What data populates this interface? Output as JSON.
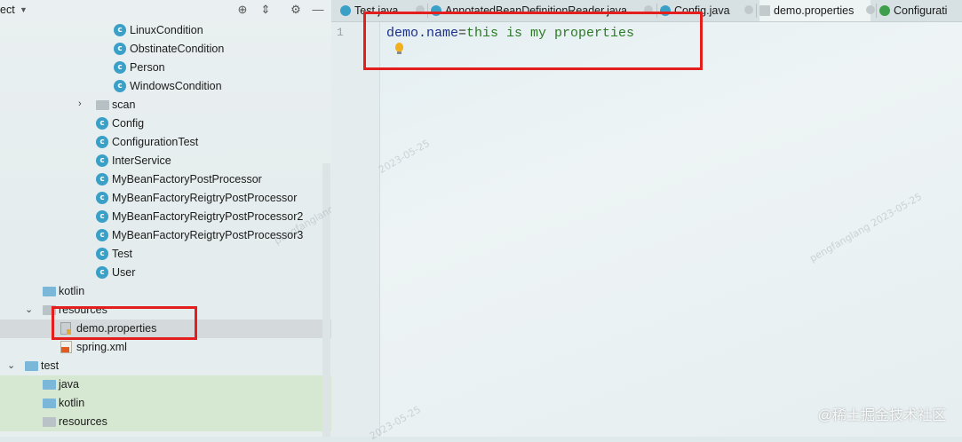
{
  "left_panel": {
    "title": "ect",
    "tree": [
      {
        "label": "LinuxCondition",
        "icon": "class-icon",
        "indent": 128
      },
      {
        "label": "ObstinateCondition",
        "icon": "class-icon",
        "indent": 128
      },
      {
        "label": "Person",
        "icon": "class-icon",
        "indent": 128
      },
      {
        "label": "WindowsCondition",
        "icon": "class-icon",
        "indent": 128
      },
      {
        "label": "scan",
        "icon": "folder-icon",
        "indent": 108,
        "arrow": "›"
      },
      {
        "label": "Config",
        "icon": "class-icon",
        "indent": 108
      },
      {
        "label": "ConfigurationTest",
        "icon": "class-icon",
        "indent": 108
      },
      {
        "label": "InterService",
        "icon": "class-icon",
        "indent": 108
      },
      {
        "label": "MyBeanFactoryPostProcessor",
        "icon": "class-icon",
        "indent": 108
      },
      {
        "label": "MyBeanFactoryReigtryPostProcessor",
        "icon": "class-icon",
        "indent": 108
      },
      {
        "label": "MyBeanFactoryReigtryPostProcessor2",
        "icon": "class-icon",
        "indent": 108
      },
      {
        "label": "MyBeanFactoryReigtryPostProcessor3",
        "icon": "class-icon",
        "indent": 108
      },
      {
        "label": "Test",
        "icon": "class-icon",
        "indent": 108
      },
      {
        "label": "User",
        "icon": "class-icon",
        "indent": 108
      },
      {
        "label": "kotlin",
        "icon": "folder-icon",
        "indent": 48
      },
      {
        "label": "resources",
        "icon": "folder-icon",
        "indent": 48,
        "arrow": "⌄"
      },
      {
        "label": "demo.properties",
        "icon": "properties-icon",
        "indent": 68,
        "selected": true
      },
      {
        "label": "spring.xml",
        "icon": "xml-icon",
        "indent": 68
      },
      {
        "label": "test",
        "icon": "folder-icon",
        "indent": 28,
        "arrow": "⌄"
      },
      {
        "label": "java",
        "icon": "folder-icon",
        "indent": 48,
        "green": true
      },
      {
        "label": "kotlin",
        "icon": "folder-icon",
        "indent": 48,
        "green": true
      },
      {
        "label": "resources",
        "icon": "folder-icon",
        "indent": 48,
        "green": true
      }
    ]
  },
  "tabs": [
    {
      "label": "Test.java",
      "icon": "class-icon"
    },
    {
      "label": "AnnotatedBeanDefinitionReader.java",
      "icon": "class-icon"
    },
    {
      "label": "Config.java",
      "icon": "class-icon"
    },
    {
      "label": "demo.properties",
      "icon": "properties-icon",
      "active": true
    },
    {
      "label": "Configurati",
      "icon": "annotation-icon"
    }
  ],
  "editor": {
    "line_number": "1",
    "key": "demo.name",
    "equals": "=",
    "value": "this is my properties"
  },
  "watermarks": [
    "pengfanglang 2023-05-25",
    "pengfanglang 2023-05-25",
    "2023-05-25",
    "2023-05-25"
  ],
  "footer_watermark": "@稀土掘金技术社区",
  "colors": {
    "highlight": "#e41d1d",
    "class_icon": "#3aa0c8",
    "string_value": "#2b7a24",
    "property_key": "#1a2f8c"
  }
}
